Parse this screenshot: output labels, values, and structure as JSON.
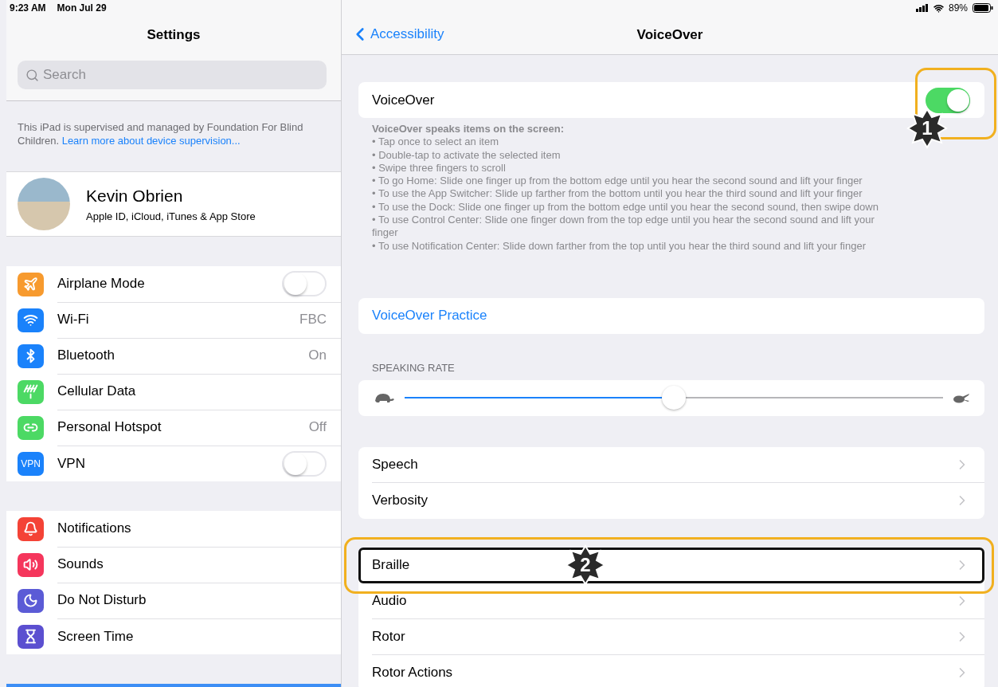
{
  "status_bar": {
    "time": "9:23 AM",
    "date": "Mon Jul 29",
    "battery": "89%"
  },
  "sidebar": {
    "title": "Settings",
    "search": {
      "placeholder": "Search"
    },
    "supervision": {
      "text": "This iPad is supervised and managed by Foundation For Blind Children.",
      "link": "Learn more about device supervision..."
    },
    "profile": {
      "name": "Kevin Obrien",
      "subtitle": "Apple ID, iCloud, iTunes & App Store"
    },
    "groups": [
      [
        {
          "label": "Airplane Mode",
          "kind": "toggle",
          "on": false,
          "color": "#f79a2e"
        },
        {
          "label": "Wi-Fi",
          "kind": "value",
          "value": "FBC",
          "color": "#1a82fb"
        },
        {
          "label": "Bluetooth",
          "kind": "value",
          "value": "On",
          "color": "#1a82fb"
        },
        {
          "label": "Cellular Data",
          "kind": "plain",
          "color": "#4cd964"
        },
        {
          "label": "Personal Hotspot",
          "kind": "value",
          "value": "Off",
          "color": "#4cd964"
        },
        {
          "label": "VPN",
          "kind": "toggle",
          "on": false,
          "color": "#1a82fb",
          "icon_text": "VPN"
        }
      ],
      [
        {
          "label": "Notifications",
          "kind": "plain",
          "color": "#f44336"
        },
        {
          "label": "Sounds",
          "kind": "plain",
          "color": "#f5365c"
        },
        {
          "label": "Do Not Disturb",
          "kind": "plain",
          "color": "#5b5bd6"
        },
        {
          "label": "Screen Time",
          "kind": "plain",
          "color": "#5b4fd0"
        }
      ]
    ]
  },
  "detail": {
    "back": "Accessibility",
    "title": "VoiceOver",
    "voiceover": {
      "label": "VoiceOver",
      "on": true,
      "callout": "1"
    },
    "description": {
      "heading": "VoiceOver speaks items on the screen:",
      "bullets": [
        "• Tap once to select an item",
        "• Double-tap to activate the selected item",
        "• Swipe three fingers to scroll",
        "• To go Home: Slide one finger up from the bottom edge until you hear the second sound and lift your finger",
        "• To use the App Switcher: Slide up farther from the bottom until you hear the third sound and lift your finger",
        "• To use the Dock: Slide one finger up from the bottom edge until you hear the second sound, then swipe down",
        "• To use Control Center: Slide one finger down from the top edge until you hear the second sound and lift your finger",
        "• To use Notification Center: Slide down farther from the top until you hear the third sound and lift your finger"
      ]
    },
    "practice": "VoiceOver Practice",
    "speaking_rate": {
      "label": "SPEAKING RATE",
      "level": 0.5
    },
    "groups": [
      [
        {
          "label": "Speech",
          "highlighted": false
        },
        {
          "label": "Verbosity",
          "highlighted": false
        }
      ],
      [
        {
          "label": "Braille",
          "highlighted": true,
          "callout": "2"
        },
        {
          "label": "Audio",
          "highlighted": false
        },
        {
          "label": "Rotor",
          "highlighted": false
        },
        {
          "label": "Rotor Actions",
          "highlighted": false
        }
      ]
    ]
  }
}
